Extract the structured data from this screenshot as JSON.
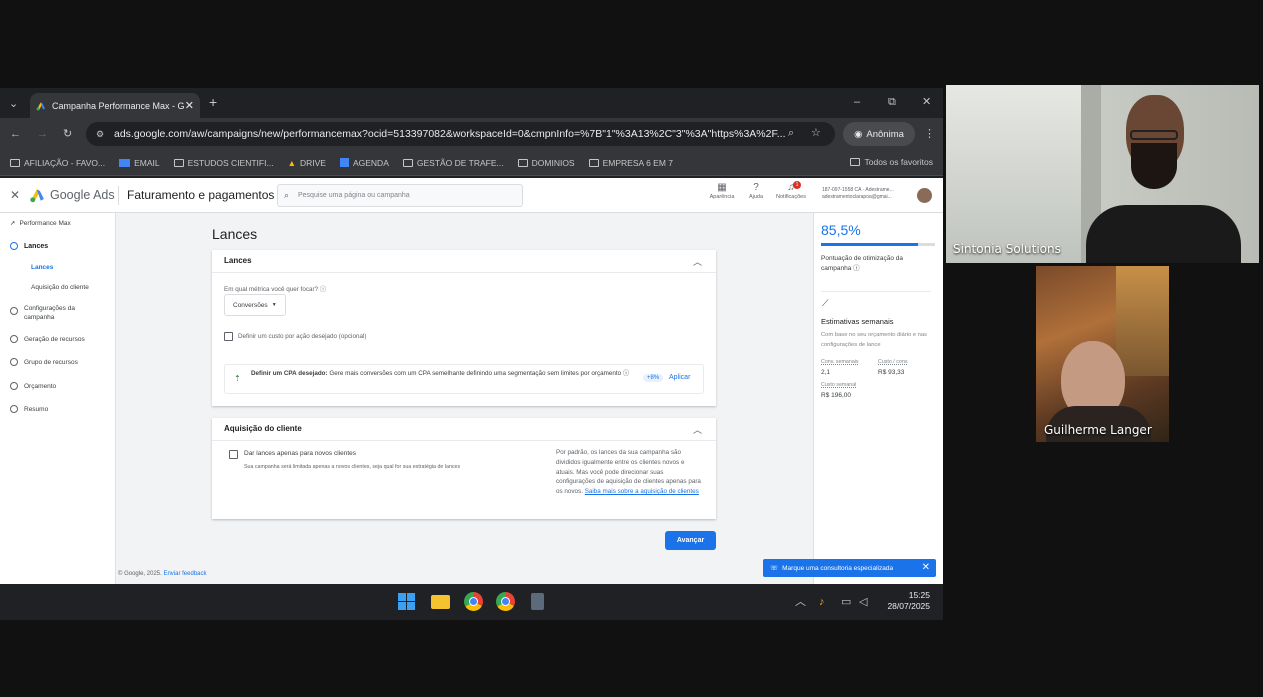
{
  "browser": {
    "tab_title": "Campanha Performance Max - G",
    "url": "ads.google.com/aw/campaigns/new/performancemax?ocid=513397082&workspaceId=0&cmpnInfo=%7B\"1\"%3A13%2C\"3\"%3A\"https%3A%2F...",
    "profile_label": "Anônima",
    "bookmarks": [
      "AFILIAÇÃO - FAVO...",
      "EMAIL",
      "ESTUDOS CIENTIFI...",
      "DRIVE",
      "AGENDA",
      "GESTÃO DE TRAFE...",
      "DOMINIOS",
      "EMPRESA 6 EM 7"
    ],
    "all_bookmarks": "Todos os favoritos"
  },
  "ads": {
    "logo_text": "Google Ads",
    "section_title": "Faturamento e pagamentos",
    "search_placeholder": "Pesquise uma página ou campanha",
    "header_icons": [
      "Aparência",
      "Ajuda",
      "Notificações"
    ],
    "notification_count": "1",
    "account_line1": "187-097-1558 CA · Adestrame...",
    "account_line2": "adestramentoclarapoa@gmai...",
    "sidebar": {
      "campaign_type": "Performance Max",
      "items": [
        "Lances",
        "Configurações da campanha",
        "Geração de recursos",
        "Grupo de recursos",
        "Orçamento",
        "Resumo"
      ],
      "sub_items": [
        "Lances",
        "Aquisição do cliente"
      ]
    },
    "page_title": "Lances",
    "bids_card": {
      "title": "Lances",
      "question": "Em qual métrica você quer focar?",
      "select_value": "Conversões",
      "checkbox_label": "Definir um custo por ação desejado (opcional)",
      "tip_bold": "Definir um CPA desejado:",
      "tip_text": "Gere mais conversões com um CPA semelhante definindo uma segmentação sem limites por orçamento",
      "tip_badge": "+8%",
      "tip_action": "Aplicar"
    },
    "acquisition_card": {
      "title": "Aquisição do cliente",
      "checkbox_label": "Dar lances apenas para novos clientes",
      "checkbox_sub": "Sua campanha será limitada apenas a novos clientes, seja qual for sua estratégia de lances",
      "info_text": "Por padrão, os lances da sua campanha são divididos igualmente entre os clientes novos e atuais. Mas você pode direcionar suas configurações de aquisição de clientes apenas para os novos.",
      "info_link": "Saiba mais sobre a aquisição de clientes"
    },
    "next_button": "Avançar",
    "footer": "© Google, 2025.",
    "footer_link": "Enviar feedback",
    "optimization_score": "85,5%",
    "optimization_score_fraction": 0.855,
    "optimization_label": "Pontuação de otimização da campanha",
    "estimates_title": "Estimativas semanais",
    "estimates_desc": "Com base no seu orçamento diário e nas configurações de lance",
    "estimates": [
      {
        "label": "Conv. semanais",
        "value": "2,1"
      },
      {
        "label": "Custo / conv.",
        "value": "R$ 93,33"
      },
      {
        "label": "Custo semanal",
        "value": "R$ 196,00"
      }
    ],
    "consult_banner": "Marque uma consultoria especializada"
  },
  "taskbar": {
    "time": "15:25",
    "date": "28/07/2025"
  },
  "participants": [
    {
      "name": "Sintonia Solutions"
    },
    {
      "name": "Guilherme Langer"
    }
  ],
  "colors": {
    "ads_blue": "#1a73e8",
    "chrome_dark": "#202124",
    "meeting_bg": "#000000"
  }
}
